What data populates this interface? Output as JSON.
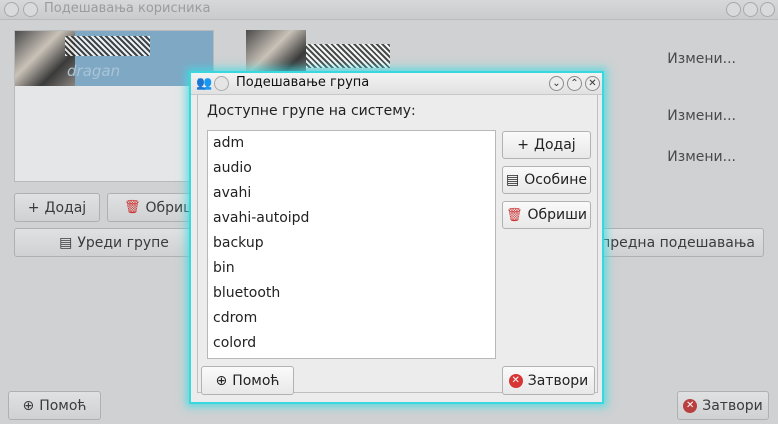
{
  "background_window": {
    "title": "Подешавања корисника",
    "username": "dragan",
    "change_links": [
      "Измени...",
      "Измени...",
      "Измени..."
    ],
    "add_label": "Додај",
    "delete_label": "Обриш",
    "edit_groups_label": "Уреди групе",
    "advanced_label": "Напредна подешавања",
    "help_label": "Помоћ",
    "close_label": "Затвори"
  },
  "dialog": {
    "title": "Подешавање група",
    "available_label": "Доступне групе на систему:",
    "groups": [
      "adm",
      "audio",
      "avahi",
      "avahi-autoipd",
      "backup",
      "bin",
      "bluetooth",
      "cdrom",
      "colord"
    ],
    "add_label": "Додај",
    "properties_label": "Особине",
    "delete_label": "Обриши",
    "help_label": "Помоћ",
    "close_label": "Затвори"
  },
  "colors": {
    "dialog_glow": "#39d7de",
    "selected_row": "#7fa8c4",
    "close_icon": "#d83535"
  }
}
